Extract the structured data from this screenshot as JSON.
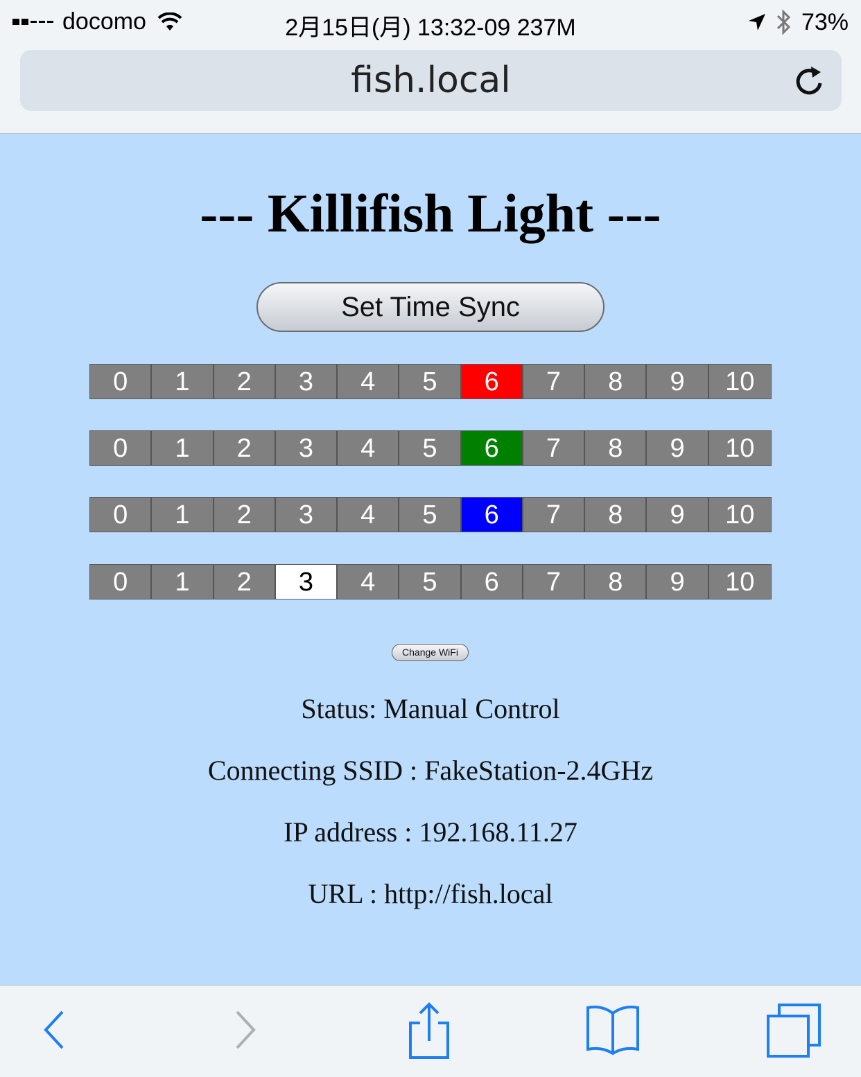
{
  "status_bar": {
    "carrier": "docomo",
    "center_text": "2月15日(月) 13:32-09 237M",
    "battery": "73%"
  },
  "address_bar": {
    "url": "fish.local"
  },
  "page": {
    "title": "--- Killifish Light ---",
    "sync_button": "Set Time Sync",
    "scale_labels": [
      "0",
      "1",
      "2",
      "3",
      "4",
      "5",
      "6",
      "7",
      "8",
      "9",
      "10"
    ],
    "rows": [
      {
        "selected": 6,
        "selected_color": "#ff0000",
        "selected_text_color": "#ffffff"
      },
      {
        "selected": 6,
        "selected_color": "#008000",
        "selected_text_color": "#ffffff"
      },
      {
        "selected": 6,
        "selected_color": "#0000ff",
        "selected_text_color": "#ffffff"
      },
      {
        "selected": 3,
        "selected_color": "#ffffff",
        "selected_text_color": "#000000"
      }
    ],
    "wifi_button": "Change WiFi",
    "status": "Status: Manual Control",
    "ssid": "Connecting SSID : FakeStation-2.4GHz",
    "ip": "IP address : 192.168.11.27",
    "url_line": "URL : http://fish.local"
  },
  "colors": {
    "page_bg": "#bbdcfd",
    "cell_bg": "#808080",
    "toolbar_icon": "#1f7ef0"
  },
  "toolbar": [
    "back-icon",
    "forward-icon",
    "share-icon",
    "bookmarks-icon",
    "tabs-icon"
  ]
}
